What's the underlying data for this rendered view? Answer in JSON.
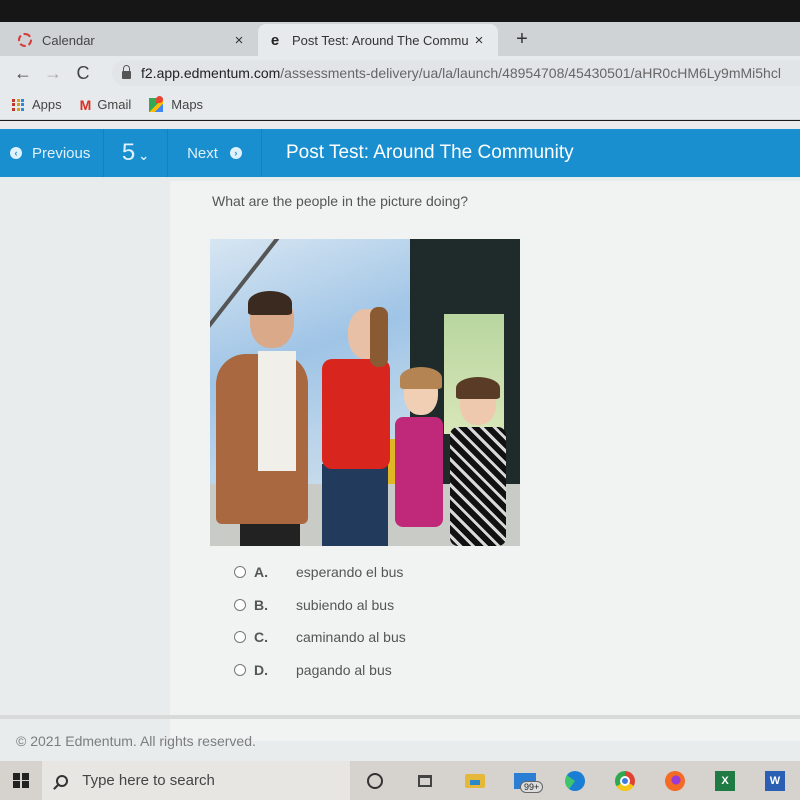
{
  "browser": {
    "tabs": [
      {
        "label": "Calendar",
        "icon": "calendar-favicon",
        "active": false
      },
      {
        "label": "Post Test: Around The Communit",
        "icon": "edmentum-favicon",
        "active": true
      }
    ],
    "new_tab_label": "+",
    "close_label": "×",
    "nav": {
      "back": "←",
      "forward": "→",
      "reload": "C"
    },
    "url": {
      "host": "f2.app.edmentum.com",
      "path": "/assessments-delivery/ua/la/launch/48954708/45430501/aHR0cHM6Ly9mMi5hcl"
    },
    "bookmarks": [
      {
        "label": "Apps",
        "icon": "apps-grid-icon"
      },
      {
        "label": "Gmail",
        "icon": "gmail-icon"
      },
      {
        "label": "Maps",
        "icon": "maps-icon"
      }
    ]
  },
  "toolbar": {
    "previous_label": "Previous",
    "question_number": "5",
    "next_label": "Next",
    "test_title": "Post Test: Around The Community",
    "accent_color": "#1a8fcf"
  },
  "question": {
    "prompt": "What are the people in the picture doing?",
    "image_alt": "A man, a woman and two girls standing beside the open door of a yellow bus",
    "options": [
      {
        "letter": "A.",
        "text": "esperando el bus",
        "selected": false
      },
      {
        "letter": "B.",
        "text": "subiendo al bus",
        "selected": false
      },
      {
        "letter": "C.",
        "text": "caminando al bus",
        "selected": false
      },
      {
        "letter": "D.",
        "text": "pagando al bus",
        "selected": false
      }
    ]
  },
  "footer": {
    "copyright": "© 2021 Edmentum. All rights reserved."
  },
  "taskbar": {
    "search_placeholder": "Type here to search",
    "mail_badge": "99+",
    "excel_letter": "X",
    "word_letter": "W",
    "apps": [
      "cortana",
      "task-view",
      "file-explorer",
      "mail",
      "edge",
      "chrome",
      "firefox",
      "excel",
      "word"
    ]
  }
}
